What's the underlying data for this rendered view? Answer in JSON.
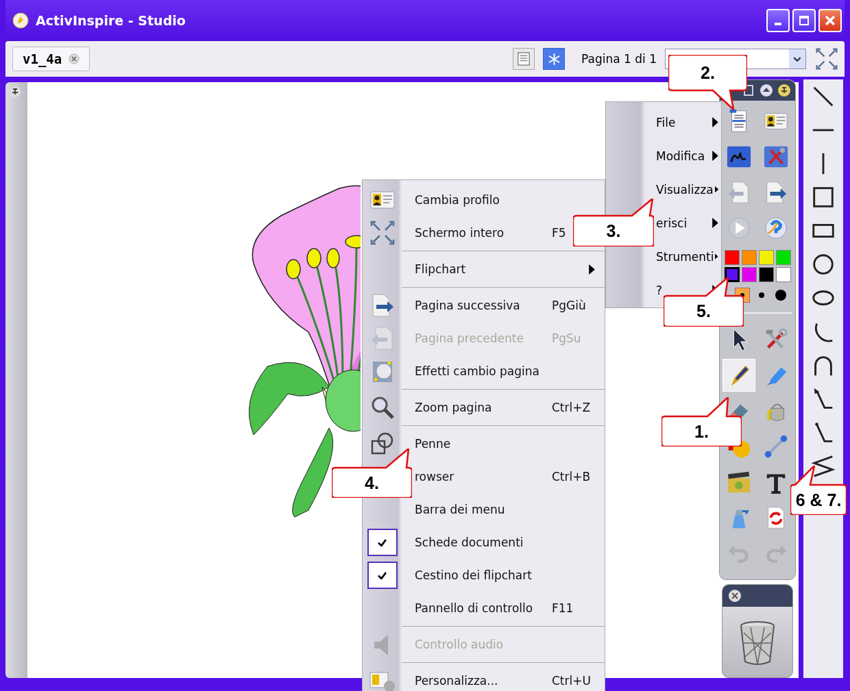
{
  "window": {
    "title": "ActivInspire - Studio"
  },
  "tabs": [
    {
      "label": "v1_4a",
      "selected": true
    }
  ],
  "page_indicator": "Pagina 1 di 1",
  "submenu": {
    "items": [
      {
        "label": "File"
      },
      {
        "label": "Modifica"
      },
      {
        "label": "Visualizza"
      },
      {
        "label": "erisci"
      },
      {
        "label": "Strumenti"
      },
      {
        "label": "?"
      }
    ]
  },
  "menu": {
    "groups": [
      [
        {
          "label": "Cambia profilo",
          "checked": false,
          "disabled": false
        },
        {
          "label": "Schermo intero",
          "shortcut": "F5",
          "checked": false,
          "disabled": false
        }
      ],
      [
        {
          "label": "Flipchart",
          "checked": false,
          "disabled": false,
          "submenu": true
        }
      ],
      [
        {
          "label": "Pagina successiva",
          "shortcut": "PgGiù",
          "checked": false,
          "disabled": false
        },
        {
          "label": "Pagina precedente",
          "shortcut": "PgSu",
          "checked": false,
          "disabled": true
        },
        {
          "label": "Effetti cambio pagina",
          "checked": false,
          "disabled": false
        }
      ],
      [
        {
          "label": "Zoom pagina",
          "shortcut": "Ctrl+Z",
          "checked": false,
          "disabled": false
        }
      ],
      [
        {
          "label": "Penne",
          "checked": false,
          "disabled": false
        },
        {
          "label": "rowser",
          "shortcut": "Ctrl+B",
          "checked": false,
          "disabled": false
        },
        {
          "label": "Barra dei menu",
          "checked": false,
          "disabled": false
        },
        {
          "label": "Schede documenti",
          "checked": true,
          "disabled": false
        },
        {
          "label": "Cestino dei flipchart",
          "checked": true,
          "disabled": false
        },
        {
          "label": "Pannello di controllo",
          "shortcut": "F11",
          "checked": false,
          "disabled": false
        }
      ],
      [
        {
          "label": "Controllo audio",
          "checked": false,
          "disabled": true
        }
      ],
      [
        {
          "label": "Personalizza...",
          "shortcut": "Ctrl+U",
          "checked": false,
          "disabled": false
        }
      ]
    ]
  },
  "toolbox": {
    "top_tools": [
      {
        "kind": "menudoc",
        "selected": false,
        "disabled": false
      },
      {
        "kind": "profile",
        "selected": false,
        "disabled": false
      },
      {
        "kind": "annotate",
        "selected": false,
        "disabled": false
      },
      {
        "kind": "desktoptools",
        "selected": false,
        "disabled": false
      },
      {
        "kind": "prevpage",
        "selected": false,
        "disabled": false
      },
      {
        "kind": "nextpage",
        "selected": false,
        "disabled": false
      },
      {
        "kind": "play",
        "selected": false,
        "disabled": false
      },
      {
        "kind": "help",
        "selected": false,
        "disabled": false
      }
    ],
    "colors": [
      {
        "color": "#ff0000",
        "selected": false
      },
      {
        "color": "#ff8c00",
        "selected": false
      },
      {
        "color": "#f0f000",
        "selected": false
      },
      {
        "color": "#00e000",
        "selected": false
      },
      {
        "color": "#5a10f0",
        "selected": true
      },
      {
        "color": "#e000f0",
        "selected": false
      },
      {
        "color": "#000000",
        "selected": false
      },
      {
        "color": "#ffffff",
        "selected": false
      }
    ],
    "pen_widths": [
      {
        "selected": true
      },
      {
        "selected": false
      },
      {
        "selected": false
      }
    ],
    "tools": [
      {
        "kind": "pointer",
        "selected": false,
        "disabled": false
      },
      {
        "kind": "tools",
        "selected": false,
        "disabled": false
      },
      {
        "kind": "pen",
        "selected": true,
        "disabled": false
      },
      {
        "kind": "highlighter",
        "selected": false,
        "disabled": false
      },
      {
        "kind": "eraser",
        "selected": false,
        "disabled": false
      },
      {
        "kind": "fill",
        "selected": false,
        "disabled": false
      },
      {
        "kind": "shapes",
        "selected": false,
        "disabled": false
      },
      {
        "kind": "connector",
        "selected": false,
        "disabled": false
      },
      {
        "kind": "media",
        "selected": false,
        "disabled": false
      },
      {
        "kind": "text",
        "selected": false,
        "disabled": false
      },
      {
        "kind": "clear",
        "selected": false,
        "disabled": false
      },
      {
        "kind": "reset",
        "selected": false,
        "disabled": false
      },
      {
        "kind": "undo",
        "selected": false,
        "disabled": true
      },
      {
        "kind": "redo",
        "selected": false,
        "disabled": true
      }
    ]
  },
  "callouts": [
    {
      "label": "2."
    },
    {
      "label": "3."
    },
    {
      "label": "5."
    },
    {
      "label": "1."
    },
    {
      "label": "4."
    },
    {
      "label": "6 & 7."
    }
  ]
}
